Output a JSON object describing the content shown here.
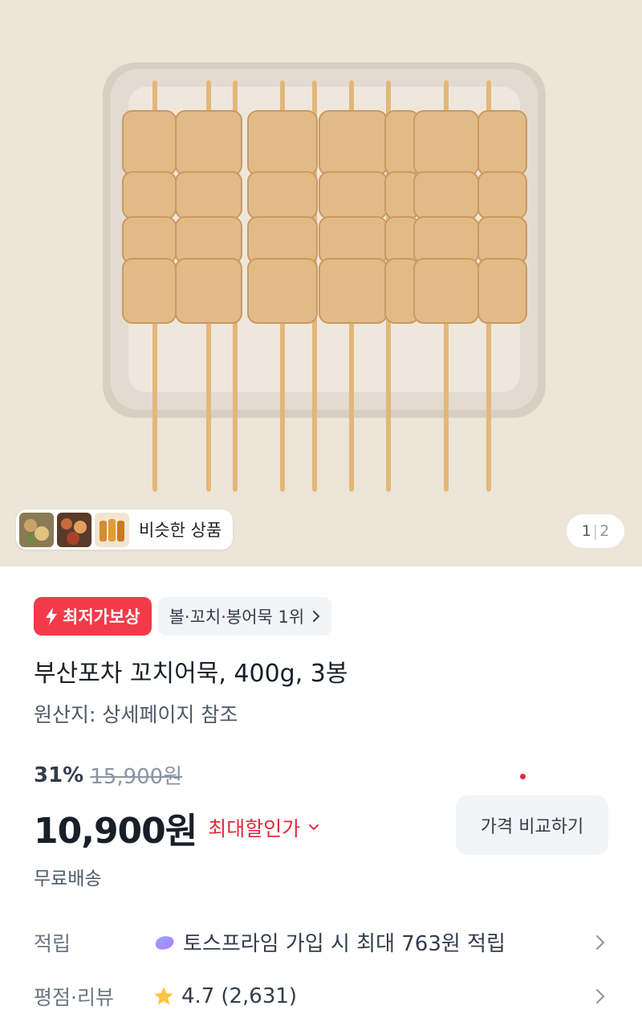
{
  "gallery": {
    "similar_label": "비슷한 상품",
    "page_current": "1",
    "page_separator": "|",
    "page_total": "2"
  },
  "badges": {
    "lowest_price": "최저가보상",
    "ranking": "볼·꼬치·봉어묵 1위"
  },
  "product": {
    "title": "부산포차 꼬치어묵, 400g, 3봉",
    "origin": "원산지: 상세페이지 참조",
    "discount_percent": "31%",
    "original_price": "15,900원",
    "price": "10,900원",
    "max_discount_label": "최대할인가",
    "compare_button": "가격 비교하기",
    "shipping": "무료배송"
  },
  "info": {
    "points_label": "적립",
    "points_value": "토스프라임 가입 시 최대 763원 적립",
    "rating_label": "평점·리뷰",
    "rating_value": "4.7",
    "review_count": "(2,631)"
  },
  "colors": {
    "accent_red": "#f33a49",
    "price_red": "#e42939",
    "star": "#ffc342"
  }
}
